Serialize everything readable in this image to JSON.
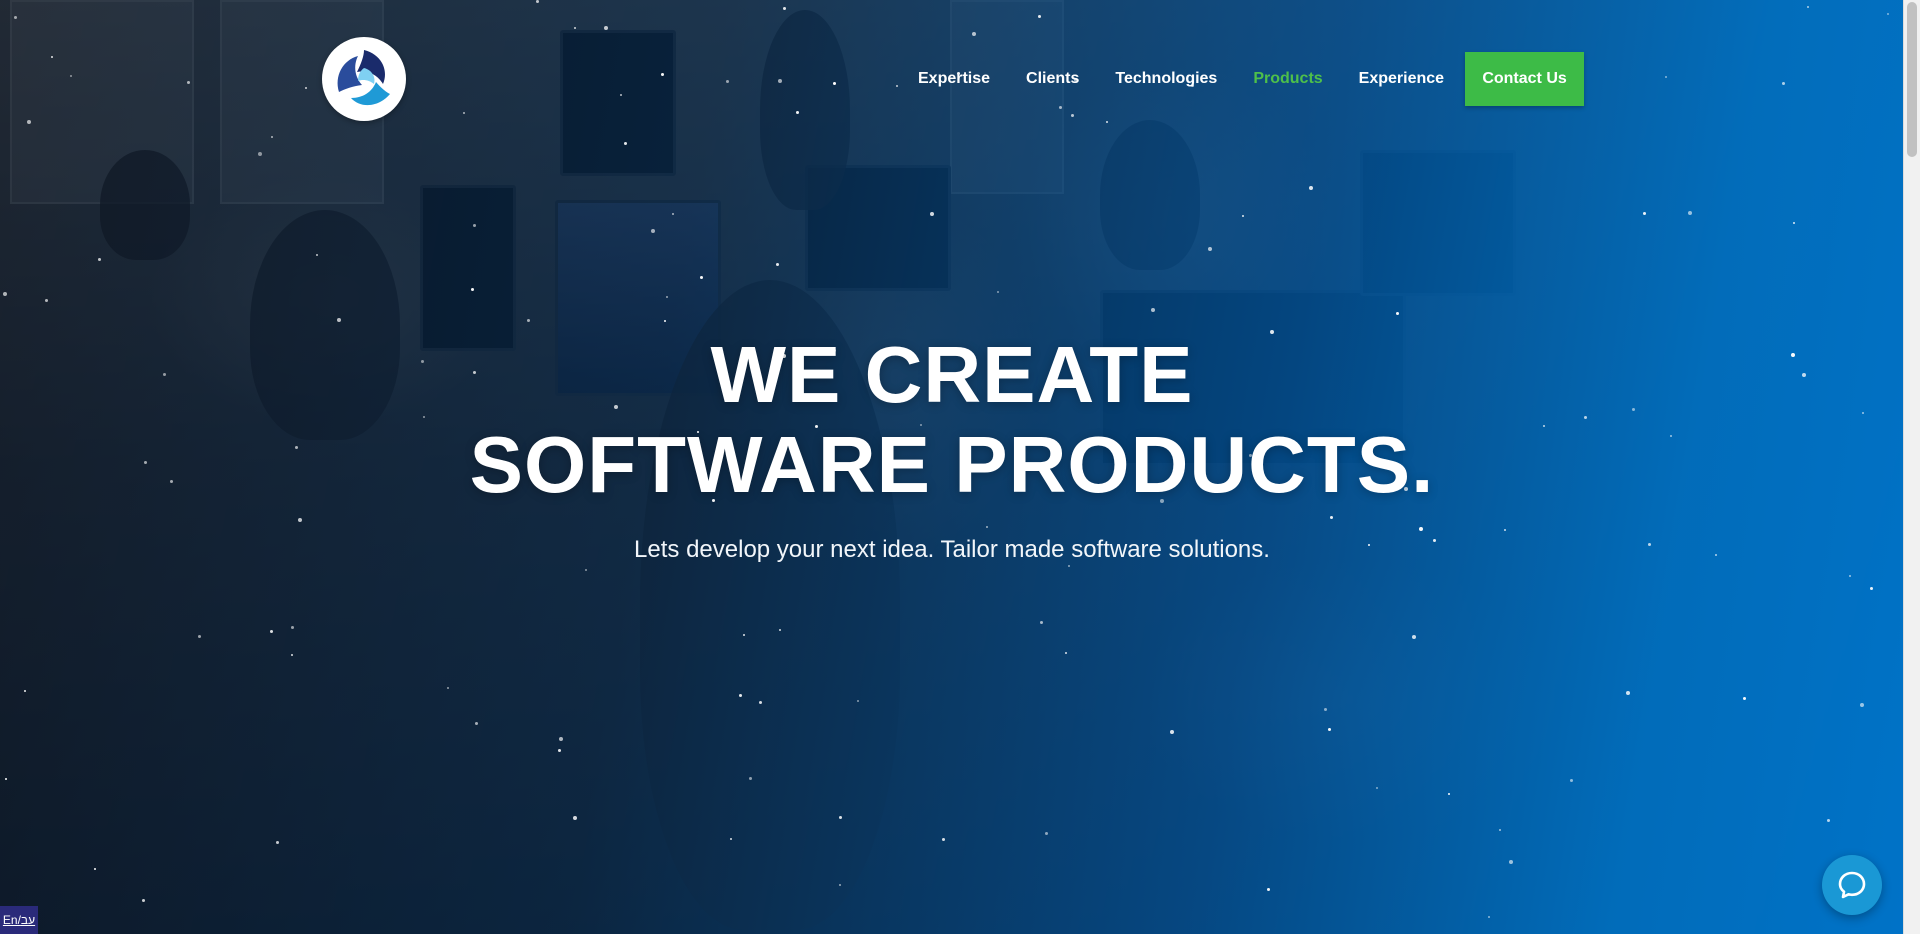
{
  "brand": {
    "logo_icon": "triskelion-swirl-logo",
    "colors": {
      "primary_blue": "#0073c8",
      "accent_green": "#3dbb47",
      "active_nav": "#4ec04a",
      "chat_blue": "#1a98d5"
    }
  },
  "nav": {
    "items": [
      {
        "label": "Expertise",
        "active": false
      },
      {
        "label": "Clients",
        "active": false
      },
      {
        "label": "Technologies",
        "active": false
      },
      {
        "label": "Products",
        "active": true
      },
      {
        "label": "Experience",
        "active": false
      }
    ],
    "cta_label": "Contact Us"
  },
  "hero": {
    "title_line1": "WE CREATE",
    "title_line2": "SOFTWARE PRODUCTS.",
    "subtitle": "Lets develop your next idea. Tailor made software solutions."
  },
  "widgets": {
    "chat_icon": "chat-bubble-icon",
    "language_label": "En/עב"
  }
}
